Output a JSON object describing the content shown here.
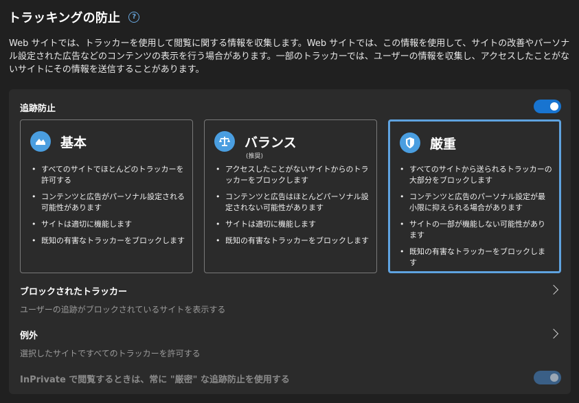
{
  "header": {
    "title": "トラッキングの防止",
    "help_icon": "question-circle-icon"
  },
  "description": "Web サイトでは、トラッカーを使用して閲覧に関する情報を収集します。Web サイトでは、この情報を使用して、サイトの改善やパーソナル設定された広告などのコンテンツの表示を行う場合があります。一部のトラッカーでは、ユーザーの情報を収集し、アクセスしたことがないサイトにその情報を送信することがあります。",
  "tracking": {
    "label": "追跡防止",
    "enabled": true
  },
  "levels": [
    {
      "title": "基本",
      "icon": "basic-shield-icon",
      "recommended": "",
      "selected": false,
      "bullets": [
        "すべてのサイトでほとんどのトラッカーを許可する",
        "コンテンツと広告がパーソナル設定される可能性があります",
        "サイトは適切に機能します",
        "既知の有害なトラッカーをブロックします"
      ]
    },
    {
      "title": "バランス",
      "icon": "balance-scale-icon",
      "recommended": "(推奨)",
      "selected": false,
      "bullets": [
        "アクセスしたことがないサイトからのトラッカーをブロックします",
        "コンテンツと広告はほとんどパーソナル設定されない可能性があります",
        "サイトは適切に機能します",
        "既知の有害なトラッカーをブロックします"
      ]
    },
    {
      "title": "厳重",
      "icon": "strict-shield-icon",
      "recommended": "",
      "selected": true,
      "bullets": [
        "すべてのサイトから送られるトラッカーの大部分をブロックします",
        "コンテンツと広告のパーソナル設定が最小限に抑えられる場合があります",
        "サイトの一部が機能しない可能性があります",
        "既知の有害なトラッカーをブロックします"
      ]
    }
  ],
  "blocked": {
    "title": "ブロックされたトラッカー",
    "subtitle": "ユーザーの追跡がブロックされているサイトを表示する"
  },
  "exceptions": {
    "title": "例外",
    "subtitle": "選択したサイトですべてのトラッカーを許可する"
  },
  "inprivate": {
    "label": "InPrivate で閲覧するときは、常に \"厳密\" な追跡防止を使用する",
    "enabled": true,
    "disabled": true
  },
  "colors": {
    "accent": "#1874d0",
    "selected_border": "#5fa3e0",
    "icon_bg": "#4a9ee0"
  }
}
